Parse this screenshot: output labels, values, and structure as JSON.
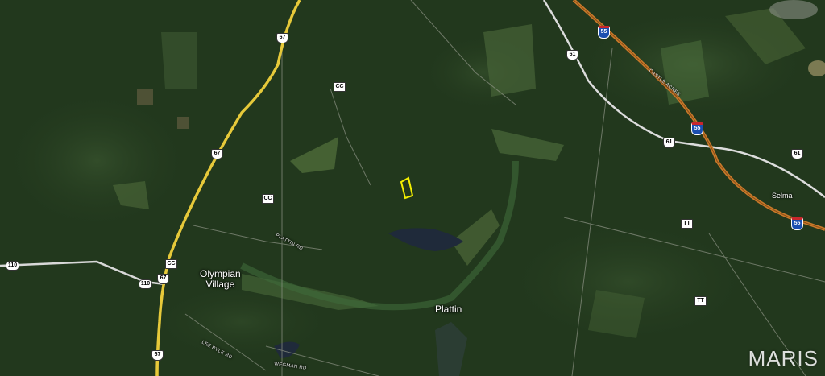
{
  "map": {
    "type": "satellite",
    "colors": {
      "forest": "#22381d",
      "forest_light": "#2f4a28",
      "field": "#4f6b3a",
      "highway_yellow": "#e6c93a",
      "interstate_orange": "#c97a2a",
      "road_white": "#e6e6e6",
      "water": "#1f2a3a",
      "parcel_outline": "#f4f000"
    },
    "places": {
      "olympian_village": "Olympian\nVillage",
      "plattin": "Plattin",
      "selma": "Selma"
    },
    "road_labels": {
      "plattin_rd": "PLATTIN RD",
      "lee_pyle_rd": "LEE PYLE RD",
      "wegman_rd": "WEGMAN RD",
      "castle_acres": "CASTLE ACRES"
    },
    "shields": {
      "us67_a": "67",
      "us67_b": "67",
      "us67_c": "67",
      "us67_d": "67",
      "us61_a": "61",
      "us61_b": "61",
      "us61_c": "61",
      "i55_a": "55",
      "i55_b": "55",
      "i55_c": "55",
      "route110_a": "110",
      "route110_b": "110",
      "cc_a": "CC",
      "cc_b": "CC",
      "cc_c": "CC",
      "tt_a": "TT",
      "tt_b": "TT"
    },
    "watermark": "MARIS"
  }
}
